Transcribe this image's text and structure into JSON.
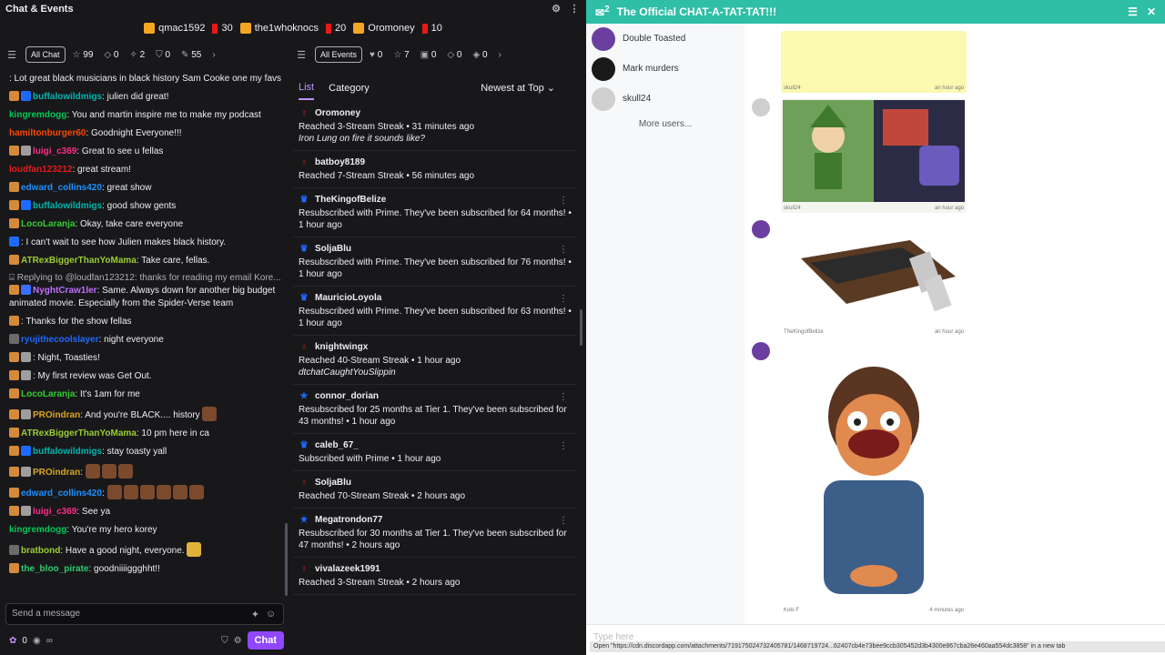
{
  "left": {
    "title": "Chat & Events",
    "leaderboard": [
      {
        "name": "qmac1592",
        "color": "#f5a623"
      },
      {
        "value": "30",
        "color": "#e91916"
      },
      {
        "name": "the1whoknocs",
        "color": "#f5a623"
      },
      {
        "value": "20",
        "color": "#e91916"
      },
      {
        "name": "Oromoney",
        "color": "#f5a623"
      },
      {
        "value": "10",
        "color": "#e91916"
      }
    ],
    "chat_filter": {
      "label": "All Chat",
      "counts": [
        "99",
        "0",
        "2",
        "0",
        "55"
      ]
    },
    "events_filter": {
      "label": "All Events",
      "counts": [
        "0",
        "7",
        "0",
        "0",
        "0"
      ]
    },
    "chat": [
      {
        "user": "",
        "color": "#1f69ff",
        "text": ": Lot great black musicians in black history Sam Cooke one my favs"
      },
      {
        "user": "buffalowildmigs",
        "color": "#00b5ad",
        "text": ": julien did great!"
      },
      {
        "user": "kingremdogg",
        "color": "#00c853",
        "text": ": You and martin inspire me to make my podcast"
      },
      {
        "user": "hamiltonburger60",
        "color": "#ff4500",
        "text": ": Goodnight Everyone!!!"
      },
      {
        "user": "luigi_c369",
        "color": "#ff2c8a",
        "text": ": Great to see u fellas"
      },
      {
        "user": "loudfan123212",
        "color": "#e91916",
        "text": ": great stream!"
      },
      {
        "user": "edward_collins420",
        "color": "#1e90ff",
        "text": ": great show"
      },
      {
        "user": "buffalowildmigs",
        "color": "#00b5ad",
        "text": ": good show gents"
      },
      {
        "user": "LocoLaranja",
        "color": "#32cd32",
        "text": ": Okay, take care everyone"
      },
      {
        "user": "",
        "color": "#e91916",
        "text": ": I can't wait to see how Julien makes black history."
      },
      {
        "user": "ATRexBiggerThanYoMama",
        "color": "#9acd32",
        "text": ": Take care, fellas."
      },
      {
        "reply": "Replying to @loudfan123212: thanks for reading my email Kore..."
      },
      {
        "user": "NyghtCraw1ler",
        "color": "#bf6fff",
        "text": ": Same. Always down for another big budget animated movie. Especially from the Spider-Verse team"
      },
      {
        "user": "",
        "color": "#ff2c8a",
        "text": ": Thanks for the show fellas"
      },
      {
        "user": "ryujithecoolslayer",
        "color": "#1f69ff",
        "text": ": night everyone"
      },
      {
        "user": "",
        "color": "#1f69ff",
        "text": ": Night, Toasties!"
      },
      {
        "user": "",
        "color": "#1f69ff",
        "text": ": My first review was Get Out."
      },
      {
        "user": "LocoLaranja",
        "color": "#32cd32",
        "text": ": It's 1am for me"
      },
      {
        "user": "PROindran",
        "color": "#daa520",
        "text": ": And you're BLACK.... history"
      },
      {
        "user": "ATRexBiggerThanYoMama",
        "color": "#9acd32",
        "text": ": 10 pm here in ca"
      },
      {
        "user": "buffalowildmigs",
        "color": "#00b5ad",
        "text": ": stay toasty yall"
      },
      {
        "user": "PROindran",
        "color": "#daa520",
        "text": ":"
      },
      {
        "user": "edward_collins420",
        "color": "#1e90ff",
        "text": ":"
      },
      {
        "user": "luigi_c369",
        "color": "#ff2c8a",
        "text": ": See ya"
      },
      {
        "user": "kingremdogg",
        "color": "#00c853",
        "text": ": You're my hero korey"
      },
      {
        "user": "bratbond",
        "color": "#9acd32",
        "text": ": Have a good night, everyone."
      },
      {
        "user": "the_bloo_pirate",
        "color": "#2ecc71",
        "text": ": goodniiiiggghht!!"
      }
    ],
    "input_placeholder": "Send a message",
    "footer": {
      "points": "0",
      "chat_button": "Chat"
    },
    "events_tabs": {
      "list": "List",
      "category": "Category",
      "sort": "Newest at Top"
    },
    "events": [
      {
        "icon": "streak",
        "name": "Oromoney",
        "line": "Reached 3-Stream Streak • 31 minutes ago",
        "note": "Iron Lung on fire it sounds like?"
      },
      {
        "icon": "streak",
        "name": "batboy8189",
        "line": "Reached 7-Stream Streak • 56 minutes ago"
      },
      {
        "icon": "sub",
        "name": "TheKingofBelize",
        "line": "Resubscribed with Prime. They've been subscribed for 64 months! • 1 hour ago"
      },
      {
        "icon": "sub",
        "name": "SoljaBlu",
        "line": "Resubscribed with Prime. They've been subscribed for 76 months! • 1 hour ago"
      },
      {
        "icon": "sub",
        "name": "MauricioLoyola",
        "line": "Resubscribed with Prime. They've been subscribed for 63 months! • 1 hour ago"
      },
      {
        "icon": "streak",
        "name": "knightwingx",
        "line": "Reached 40-Stream Streak • 1 hour ago",
        "note": "dtchatCaughtYouSlippin"
      },
      {
        "icon": "star",
        "name": "connor_dorian",
        "line": "Resubscribed for 25 months at Tier 1. They've been subscribed for 43 months! • 1 hour ago"
      },
      {
        "icon": "sub",
        "name": "caleb_67_",
        "line": "Subscribed with Prime • 1 hour ago"
      },
      {
        "icon": "streak",
        "name": "SoljaBlu",
        "line": "Reached 70-Stream Streak • 2 hours ago"
      },
      {
        "icon": "star",
        "name": "Megatrondon77",
        "line": "Resubscribed for 30 months at Tier 1. They've been subscribed for 47 months! • 2 hours ago"
      },
      {
        "icon": "streak",
        "name": "vivalazeek1991",
        "line": "Reached 3-Stream Streak • 2 hours ago"
      }
    ]
  },
  "right": {
    "title": "The Official CHAT-A-TAT-TAT!!!",
    "badge_count": "2",
    "accent": "#2fbea6",
    "users": [
      {
        "name": "Double Toasted",
        "color": "#6b3fa0"
      },
      {
        "name": "Mark murders",
        "color": "#1a1a1a"
      },
      {
        "name": "skull24",
        "color": "#cfcfcf"
      }
    ],
    "more_users": "More users...",
    "cards": [
      {
        "user": "skull24",
        "time": "an hour ago"
      },
      {
        "user": "skull24",
        "time": "an hour ago"
      },
      {
        "user": "TheKingofBelize",
        "time": "an hour ago"
      },
      {
        "user": "Koki F",
        "time": "4 minutes ago"
      }
    ],
    "input_placeholder": "Type here",
    "status_url": "Open \"https://cdn.discordapp.com/attachments/719175024732405781/1468719724...62407cb4e73bee9ccb305452d3b4300e867cba26e460aa554dc3858\" in a new tab"
  }
}
